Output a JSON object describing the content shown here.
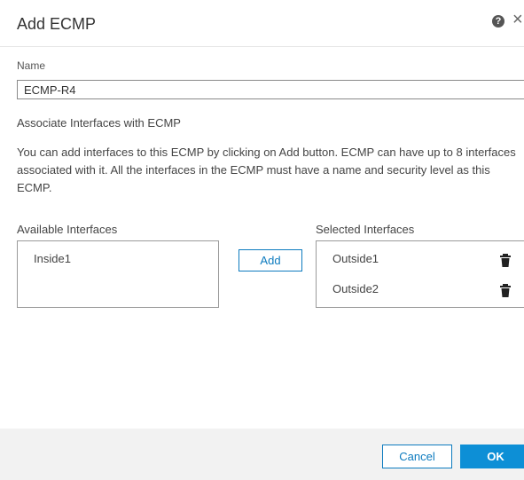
{
  "dialog": {
    "title": "Add ECMP",
    "help_icon": "question-circle-icon",
    "close_icon": "close-icon"
  },
  "name_field": {
    "label": "Name",
    "value": "ECMP-R4"
  },
  "associate": {
    "title": "Associate Interfaces with ECMP",
    "description": "You can add interfaces to this ECMP by clicking on Add button. ECMP can have up to 8 interfaces associated with it. All the interfaces in the ECMP must have a name and security level as this ECMP."
  },
  "available": {
    "label": "Available Interfaces",
    "items": [
      "Inside1"
    ]
  },
  "add_button": "Add",
  "selected": {
    "label": "Selected Interfaces",
    "items": [
      "Outside1",
      "Outside2"
    ],
    "item_icon": "trash-icon"
  },
  "footer": {
    "cancel_label": "Cancel",
    "ok_label": "OK",
    "accent_color": "#0d8fd6"
  }
}
